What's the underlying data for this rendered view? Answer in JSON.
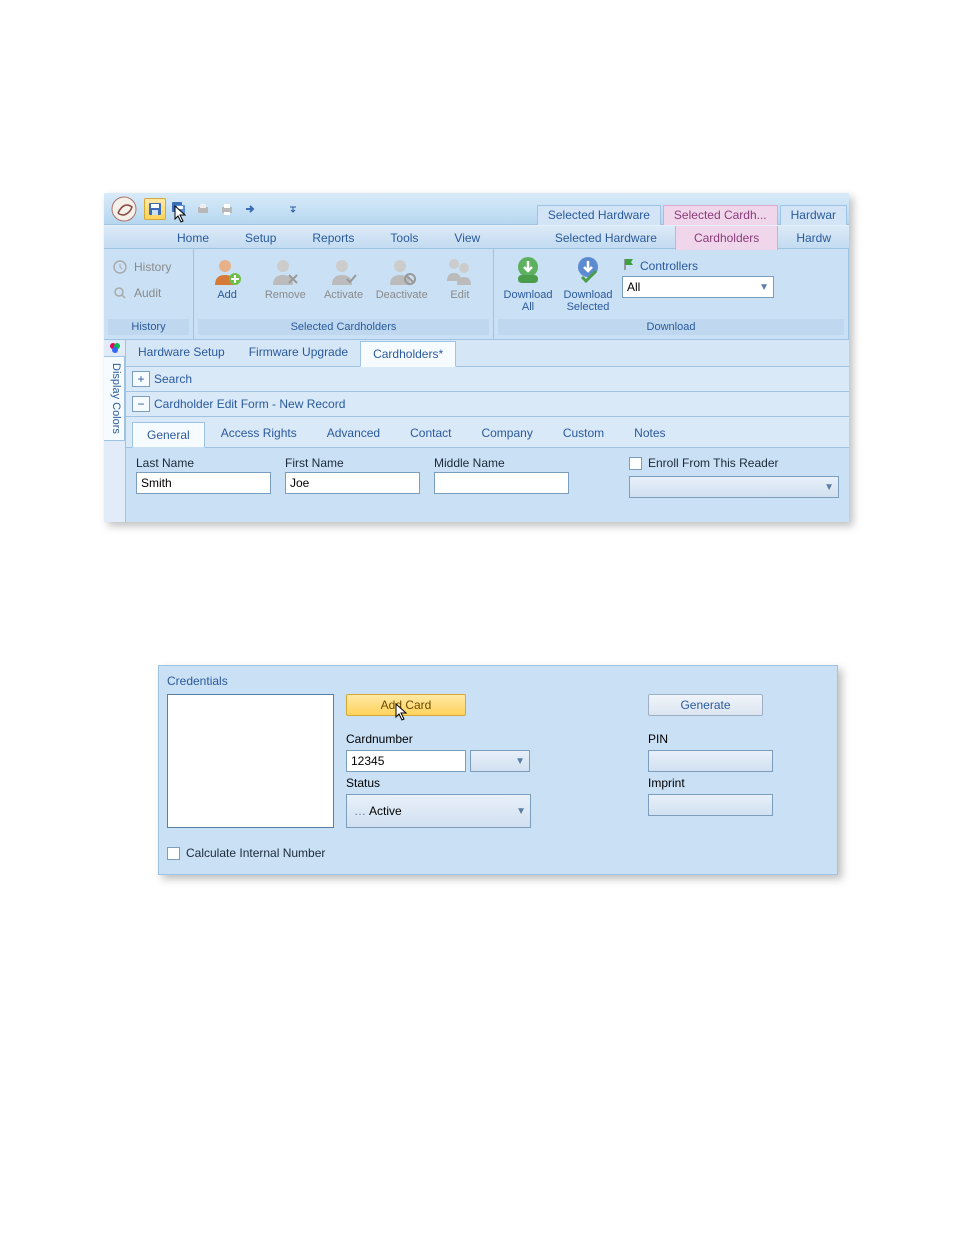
{
  "titlebar": {
    "tabs": [
      "Selected Hardware",
      "Selected  Cardh...",
      "Hardwar"
    ]
  },
  "menubar": {
    "items": [
      "Home",
      "Setup",
      "Reports",
      "Tools",
      "View"
    ],
    "right": [
      "Selected Hardware",
      "Cardholders",
      "Hardw"
    ]
  },
  "ribbon": {
    "history_group": {
      "label": "History",
      "items": [
        "History",
        "Audit"
      ]
    },
    "selected_group": {
      "label": "Selected Cardholders",
      "buttons": [
        "Add",
        "Remove",
        "Activate",
        "Deactivate",
        "Edit"
      ]
    },
    "download_group": {
      "label": "Download",
      "buttons": [
        "Download All",
        "Download Selected"
      ],
      "controllers_label": "Controllers",
      "controllers_value": "All"
    }
  },
  "side_tab": "Display Colors",
  "doc_tabs": [
    "Hardware Setup",
    "Firmware Upgrade",
    "Cardholders*"
  ],
  "search_row": {
    "label": "Search"
  },
  "edit_row": {
    "label": "Cardholder Edit Form - New Record"
  },
  "form_tabs": [
    "General",
    "Access Rights",
    "Advanced",
    "Contact",
    "Company",
    "Custom",
    "Notes"
  ],
  "form": {
    "last_name_label": "Last Name",
    "last_name": "Smith",
    "first_name_label": "First Name",
    "first_name": "Joe",
    "middle_name_label": "Middle Name",
    "middle_name": "",
    "enroll_label": "Enroll From This Reader"
  },
  "credentials": {
    "title": "Credentials",
    "add_card": "Add Card",
    "generate": "Generate",
    "cardnumber_label": "Cardnumber",
    "cardnumber": "12345",
    "status_label": "Status",
    "status": "Active",
    "pin_label": "PIN",
    "pin": "",
    "imprint_label": "Imprint",
    "imprint": "",
    "calc_label": "Calculate Internal Number"
  }
}
